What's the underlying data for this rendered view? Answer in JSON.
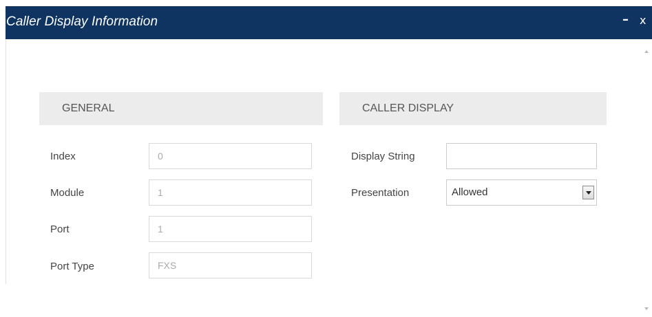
{
  "dialog": {
    "title": "Caller Display Information",
    "minimize_label": "–",
    "close_label": "x"
  },
  "general": {
    "header": "GENERAL",
    "fields": [
      {
        "label": "Index",
        "value": "0"
      },
      {
        "label": "Module",
        "value": "1"
      },
      {
        "label": "Port",
        "value": "1"
      },
      {
        "label": "Port Type",
        "value": "FXS"
      }
    ]
  },
  "caller_display": {
    "header": "CALLER DISPLAY",
    "display_string": {
      "label": "Display String",
      "value": ""
    },
    "presentation": {
      "label": "Presentation",
      "value": "Allowed"
    }
  },
  "colors": {
    "titlebar": "#0f3462",
    "section_header": "#ececec",
    "label_text": "#444444"
  }
}
